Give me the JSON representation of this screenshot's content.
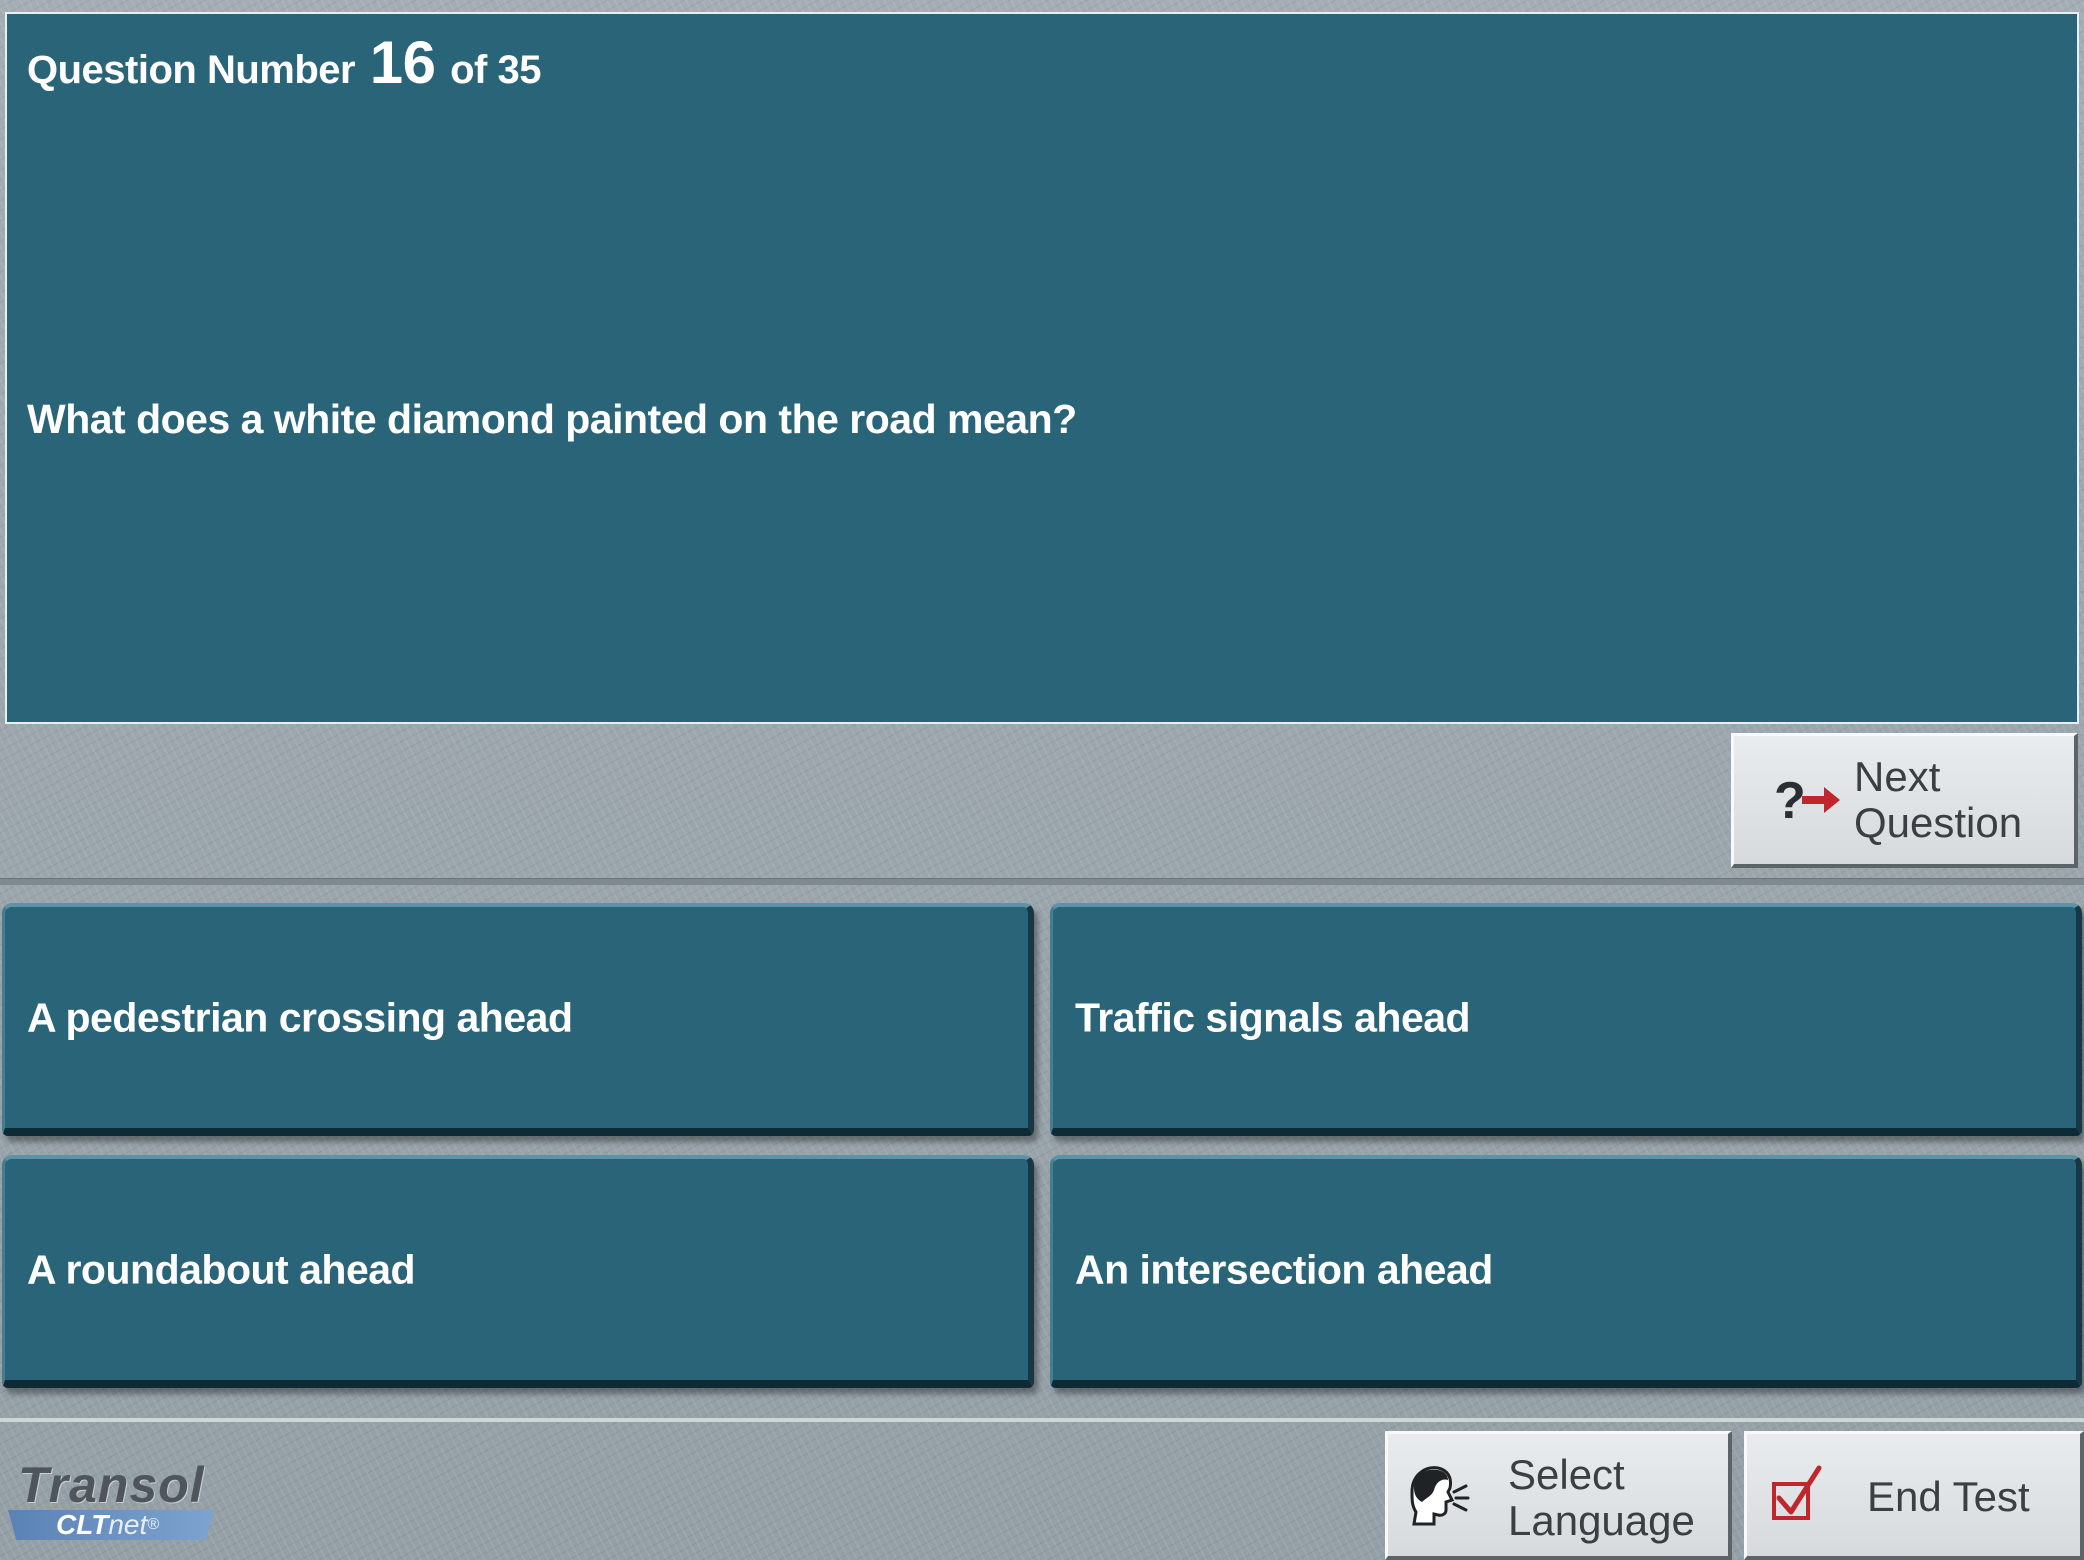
{
  "question": {
    "header_prefix": "Question Number",
    "number": "16",
    "header_suffix": "of 35",
    "text": "What does a white diamond painted on the road mean?"
  },
  "answers": [
    {
      "label": "A pedestrian crossing ahead"
    },
    {
      "label": "Traffic signals ahead"
    },
    {
      "label": "A roundabout ahead"
    },
    {
      "label": "An intersection ahead"
    }
  ],
  "buttons": {
    "next_question": {
      "label": "Next\nQuestion",
      "icon": "question-arrow-icon"
    },
    "select_language": {
      "label": "Select\nLanguage",
      "icon": "speaking-head-icon"
    },
    "end_test": {
      "label": "End Test",
      "icon": "checkbox-tick-icon"
    }
  },
  "logo": {
    "brand": "Transol",
    "product_bold": "CLT",
    "product_rest": "net",
    "mark": "®"
  },
  "colors": {
    "panel": "#2a6479",
    "panel_border": "#e9eef0",
    "background": "#9aa5ab",
    "button_face": "#e0e3e6",
    "accent_red": "#c0262b",
    "logo_blue": "#6a93c4"
  }
}
